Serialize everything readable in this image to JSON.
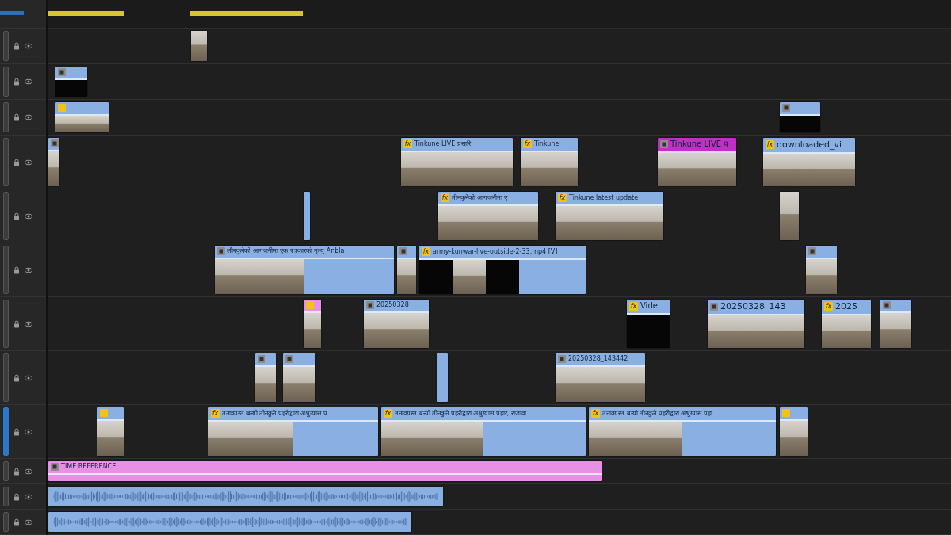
{
  "timeline": {
    "tracks": [
      {
        "targeted": false,
        "clips": [
          {
            "frames": [
              {
                "kind": "photo"
              }
            ]
          }
        ]
      },
      {
        "targeted": false,
        "clips": [
          {
            "color": "#8ab0e3",
            "badge": {
              "kind": "clip"
            },
            "frames": [
              {
                "kind": "black"
              }
            ]
          }
        ]
      },
      {
        "targeted": false,
        "clips": [
          {
            "color": "#8ab0e3",
            "badge": {
              "kind": "fx"
            },
            "frames": [
              {
                "kind": "photo"
              }
            ]
          },
          {
            "color": "#8ab0e3",
            "badge": {
              "kind": "clip"
            },
            "frames": [
              {
                "kind": "black"
              }
            ]
          }
        ]
      },
      {
        "targeted": false,
        "clips": [
          {
            "color": "#8ab0e3",
            "badge": {
              "kind": "clip"
            },
            "frames": [
              {
                "kind": "photo"
              }
            ]
          },
          {
            "label": "Tinkune LIVE प्रसारि",
            "color": "#8ab0e3",
            "badge": {
              "kind": "fx",
              "text": "fx"
            },
            "frames": [
              {
                "kind": "photo"
              }
            ]
          },
          {
            "label": "Tinkune",
            "color": "#8ab0e3",
            "badge": {
              "kind": "fx",
              "text": "fx"
            },
            "frames": [
              {
                "kind": "photo"
              }
            ]
          },
          {
            "label": "Tinkune LIVE प",
            "color": "#c22fc6",
            "badge": {
              "kind": "clip"
            },
            "frames": [
              {
                "kind": "photo"
              }
            ]
          },
          {
            "label": "downloaded_vi",
            "color": "#8ab0e3",
            "badge": {
              "kind": "fx",
              "text": "fx"
            },
            "frames": [
              {
                "kind": "photo"
              }
            ]
          }
        ]
      },
      {
        "targeted": false,
        "clips": [
          {
            "color": "#8ab0e3",
            "frames": [
              {
                "kind": "empty"
              }
            ]
          },
          {
            "label": "तीनकुनेको आगजनीमा ए",
            "color": "#8ab0e3",
            "badge": {
              "kind": "fx",
              "text": "fx"
            },
            "frames": [
              {
                "kind": "photo"
              }
            ]
          },
          {
            "label": "Tinkune latest update",
            "color": "#8ab0e3",
            "badge": {
              "kind": "fx",
              "text": "fx"
            },
            "frames": [
              {
                "kind": "photo"
              }
            ]
          },
          {
            "frames": [
              {
                "kind": "photo"
              }
            ]
          }
        ]
      },
      {
        "targeted": false,
        "clips": [
          {
            "label": "तीनकुनेको आगजनीमा एक पत्रकारको मृत्यु Anbla",
            "color": "#8ab0e3",
            "badge": {
              "kind": "clip"
            },
            "frames": [
              {
                "kind": "photo"
              },
              {
                "kind": "empty"
              }
            ]
          },
          {
            "color": "#8ab0e3",
            "badge": {
              "kind": "clip"
            },
            "frames": [
              {
                "kind": "photo"
              }
            ]
          },
          {
            "label": "army-kunwar-live-outside-2-33.mp4 [V]",
            "color": "#8ab0e3",
            "badge": {
              "kind": "fx",
              "text": "fx"
            },
            "frames": [
              {
                "kind": "black"
              },
              {
                "kind": "photo"
              },
              {
                "kind": "black"
              },
              {
                "kind": "empty"
              },
              {
                "kind": "empty"
              }
            ]
          },
          {
            "color": "#8ab0e3",
            "badge": {
              "kind": "clip"
            },
            "frames": [
              {
                "kind": "photo"
              }
            ]
          }
        ]
      },
      {
        "targeted": false,
        "clips": [
          {
            "color": "#e890e6",
            "badge": {
              "kind": "fx"
            },
            "frames": [
              {
                "kind": "photo"
              }
            ]
          },
          {
            "label": "20250328_",
            "color": "#8ab0e3",
            "badge": {
              "kind": "clip"
            },
            "frames": [
              {
                "kind": "photo"
              }
            ]
          },
          {
            "label": "Vide",
            "color": "#8ab0e3",
            "badge": {
              "kind": "fx",
              "text": "fx"
            },
            "frames": [
              {
                "kind": "black"
              }
            ]
          },
          {
            "label": "20250328_143",
            "color": "#8ab0e3",
            "badge": {
              "kind": "clip"
            },
            "frames": [
              {
                "kind": "photo"
              }
            ]
          },
          {
            "label": "2025",
            "color": "#8ab0e3",
            "badge": {
              "kind": "fx",
              "text": "fx"
            },
            "frames": [
              {
                "kind": "photo"
              }
            ]
          },
          {
            "color": "#8ab0e3",
            "badge": {
              "kind": "clip"
            },
            "frames": [
              {
                "kind": "photo"
              }
            ]
          }
        ]
      },
      {
        "targeted": false,
        "clips": [
          {
            "color": "#8ab0e3",
            "badge": {
              "kind": "clip"
            },
            "frames": [
              {
                "kind": "photo"
              }
            ]
          },
          {
            "color": "#8ab0e3",
            "badge": {
              "kind": "clip"
            },
            "frames": [
              {
                "kind": "photo"
              }
            ]
          },
          {
            "color": "#8ab0e3",
            "frames": [
              {
                "kind": "empty"
              }
            ]
          },
          {
            "label": "20250328_143442",
            "color": "#8ab0e3",
            "badge": {
              "kind": "clip"
            },
            "frames": [
              {
                "kind": "photo"
              }
            ]
          }
        ]
      },
      {
        "targeted": true,
        "clips": [
          {
            "color": "#8ab0e3",
            "badge": {
              "kind": "fx"
            },
            "frames": [
              {
                "kind": "photo"
              }
            ]
          },
          {
            "label": "तनावग्रस्त बन्यो तीनकुने प्रहरीद्वारा अश्रुग्यास प्र",
            "color": "#8ab0e3",
            "badge": {
              "kind": "fx",
              "text": "fx"
            },
            "frames": [
              {
                "kind": "photo"
              },
              {
                "kind": "empty"
              }
            ]
          },
          {
            "label": "तनावग्रस्त बन्यो तीनकुने प्रहरीद्वारा अश्रुग्यास प्रहार, राजावा",
            "color": "#8ab0e3",
            "badge": {
              "kind": "fx",
              "text": "fx"
            },
            "frames": [
              {
                "kind": "photo"
              },
              {
                "kind": "empty"
              }
            ]
          },
          {
            "label": "तनावग्रस्त बन्यो तीनकुने प्रहरीद्वारा अश्रुग्यास प्रहा",
            "color": "#8ab0e3",
            "badge": {
              "kind": "fx",
              "text": "fx"
            },
            "frames": [
              {
                "kind": "photo"
              },
              {
                "kind": "empty"
              }
            ]
          },
          {
            "color": "#8ab0e3",
            "badge": {
              "kind": "fx"
            },
            "frames": [
              {
                "kind": "photo"
              }
            ]
          }
        ]
      },
      {
        "targeted": false,
        "clips": [
          {
            "label": "TIME REFERENCE",
            "color": "#e890e6",
            "badge": {
              "kind": "clip"
            },
            "frames": [
              {
                "kind": "empty"
              }
            ]
          }
        ]
      },
      {
        "targeted": false,
        "clips": [
          {
            "color": "#8ab0e3",
            "frames": [
              {
                "kind": "waveform"
              }
            ]
          }
        ]
      },
      {
        "targeted": false,
        "clips": [
          {
            "color": "#8ab0e3",
            "frames": [
              {
                "kind": "waveform"
              }
            ]
          }
        ]
      }
    ]
  }
}
